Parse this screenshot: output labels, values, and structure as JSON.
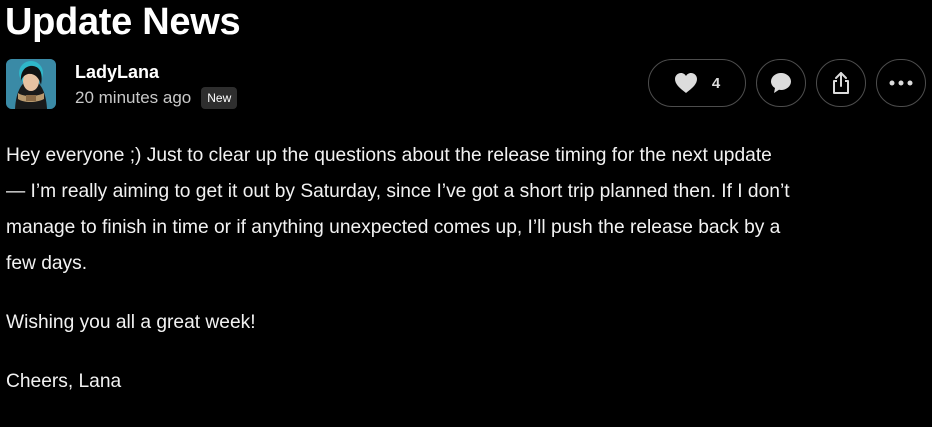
{
  "post": {
    "title": "Update News",
    "author": "LadyLana",
    "time": "20 minutes ago",
    "badge": "New"
  },
  "actions": {
    "likes": "4",
    "icons": [
      "heart-icon",
      "comment-icon",
      "share-icon",
      "more-icon"
    ]
  },
  "body": {
    "p1": [
      "Hey everyone ;) Just to clear up the questions about the release timing for the next update",
      "— I’m really aiming to get it out by Saturday, since I’ve got a short trip planned then. If I don’t",
      "manage to finish in time or if anything unexpected comes up, I’ll push the release back by a",
      "few days."
    ],
    "p2": "Wishing you all a great week!",
    "p3": "Cheers, Lana"
  },
  "colors": {
    "background": "#000000",
    "text": "#ffffff",
    "muted": "#c9c9c9",
    "border": "#4d4d4d",
    "badge_bg": "#2e2e2e"
  }
}
